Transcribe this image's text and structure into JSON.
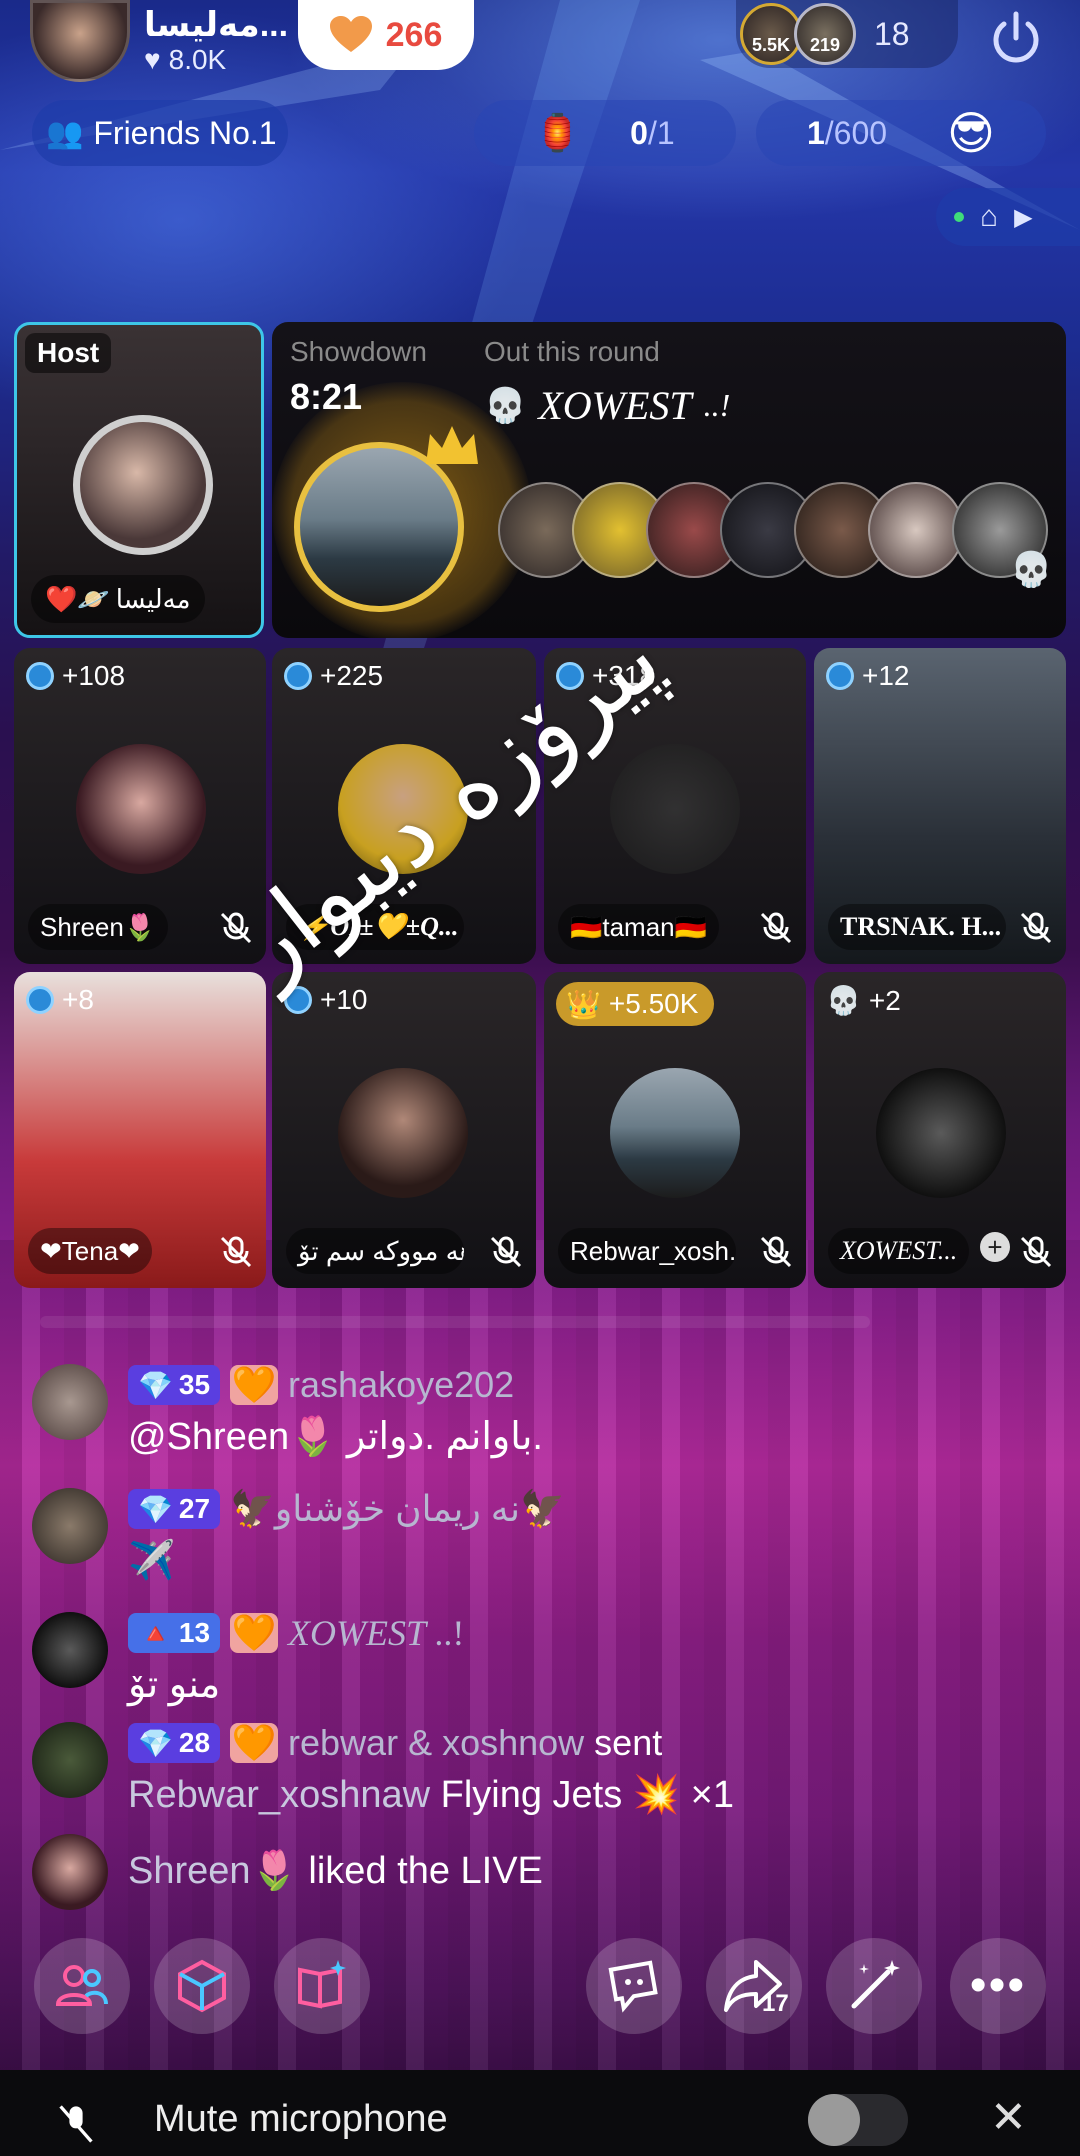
{
  "host": {
    "name": "مەلیسا...",
    "likes": "8.0K",
    "heart_count": "266"
  },
  "viewers": {
    "badge1": "5.5K",
    "badge2": "219",
    "count": "18"
  },
  "row2": {
    "friends_label": "Friends No.1",
    "goal1_done": "0",
    "goal1_total": "/1",
    "goal2_done": "1",
    "goal2_total": "/600"
  },
  "stage": {
    "host_label": "Host",
    "host_name": "مەلیسا",
    "showdown_label": "Showdown",
    "timer": "8:21",
    "out_label": "Out this round",
    "out_name": "XOWEST",
    "out_suffix": "..!"
  },
  "seats": [
    {
      "boost": "+108",
      "name": "Shreen🌷"
    },
    {
      "boost": "+225",
      "name": "⚡OI±💛±Q..."
    },
    {
      "boost": "+318",
      "name": "🇩🇪taman🇩🇪"
    },
    {
      "boost": "+12",
      "name": "TRSNAK. H..."
    },
    {
      "boost": "+8",
      "name": "❤Tena❤"
    },
    {
      "boost": "+10",
      "name": "هه مووکه سم تۆ..."
    },
    {
      "boost": "+5.50K",
      "name": "Rebwar_xosh..."
    },
    {
      "boost": "+2",
      "name": "XOWEST..."
    }
  ],
  "overlay_text": "پیرۆزە دیبوار",
  "chat": [
    {
      "level": "35",
      "name": "rashakoye202",
      "text": "@Shreen🌷  باوانم  .دواتر."
    },
    {
      "level": "27",
      "name": "🦅نه ریمان خۆشناو🦅",
      "text": "✈️"
    },
    {
      "level": "13",
      "name": "XOWEST",
      "name_suffix": "..!",
      "text": "منو تۆ"
    },
    {
      "level": "28",
      "name": "rebwar & xoshnow",
      "verb": "sent",
      "text_name": "Rebwar_xoshnaw",
      "text": "Flying Jets 💥 ×1"
    },
    {
      "name": "Shreen🌷",
      "text": "liked the LIVE"
    }
  ],
  "bottom": {
    "share_count": "17",
    "toast": "Mute microphone"
  },
  "colors": {
    "accent_host": "#3ec7e8",
    "gold": "#c99a2a",
    "heart": "#e84a3f",
    "level_badge": "#5a3ee0"
  }
}
